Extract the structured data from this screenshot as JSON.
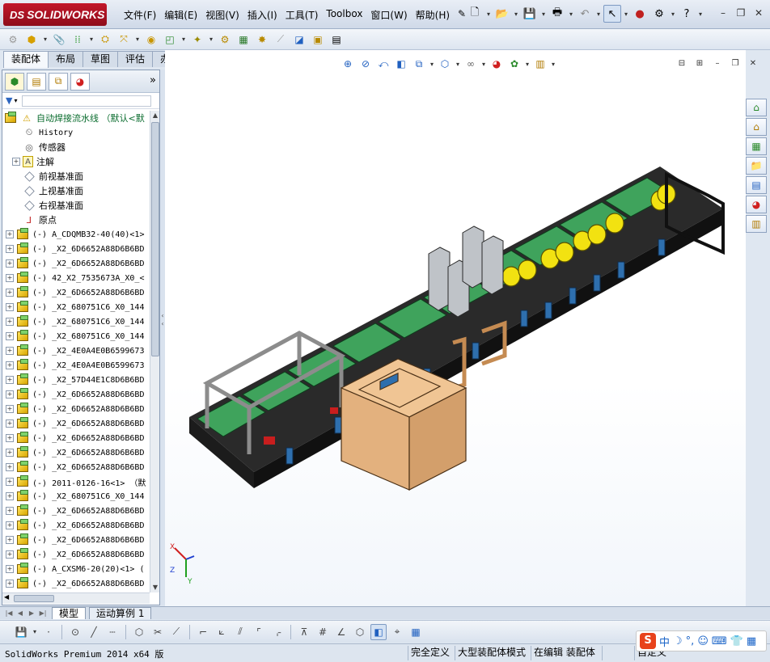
{
  "app": {
    "logo_ds": "DS",
    "logo_text": "SOLIDWORKS"
  },
  "menu": [
    "文件(F)",
    "编辑(E)",
    "视图(V)",
    "插入(I)",
    "工具(T)",
    "Toolbox",
    "窗口(W)",
    "帮助(H)"
  ],
  "cmd_tabs": [
    {
      "label": "装配体",
      "active": true
    },
    {
      "label": "布局",
      "active": false
    },
    {
      "label": "草图",
      "active": false
    },
    {
      "label": "评估",
      "active": false
    },
    {
      "label": "办公室产品",
      "active": false
    }
  ],
  "tree": {
    "root": "自动焊接流水线 （默认<默",
    "fixed_items": [
      {
        "label": "History",
        "icon": "history-icon",
        "expand": false,
        "mono": true
      },
      {
        "label": "传感器",
        "icon": "sensor-icon",
        "expand": false,
        "mono": false
      },
      {
        "label": "注解",
        "icon": "annotation-icon",
        "expand": true,
        "mono": false
      },
      {
        "label": "前视基准面",
        "icon": "plane-icon",
        "expand": false,
        "mono": false
      },
      {
        "label": "上视基准面",
        "icon": "plane-icon",
        "expand": false,
        "mono": false
      },
      {
        "label": "右视基准面",
        "icon": "plane-icon",
        "expand": false,
        "mono": false
      },
      {
        "label": "原点",
        "icon": "origin-icon",
        "expand": false,
        "mono": false
      }
    ],
    "components": [
      "(-) A_CDQMB32-40(40)<1>",
      "(-) _X2_6D6652A88D6B6BD",
      "(-) _X2_6D6652A88D6B6BD",
      "(-) 42_X2_7535673A_X0_<",
      "(-) _X2_6D6652A88D6B6BD",
      "(-) _X2_680751C6_X0_144",
      "(-) _X2_680751C6_X0_144",
      "(-) _X2_680751C6_X0_144",
      "(-) _X2_4E0A4E0B6599673",
      "(-) _X2_4E0A4E0B6599673",
      "(-) _X2_57D44E1C8D6B6BD",
      "(-) _X2_6D6652A88D6B6BD",
      "(-) _X2_6D6652A88D6B6BD",
      "(-) _X2_6D6652A88D6B6BD",
      "(-) _X2_6D6652A88D6B6BD",
      "(-) _X2_6D6652A88D6B6BD",
      "(-) _X2_6D6652A88D6B6BD",
      "(-) 2011-0126-16<1> （默",
      "(-) _X2_680751C6_X0_144",
      "(-) _X2_6D6652A88D6B6BD",
      "(-) _X2_6D6652A88D6B6BD",
      "(-) _X2_6D6652A88D6B6BD",
      "(-) _X2_6D6652A88D6B6BD",
      "(-) A_CXSM6-20(20)<1> (",
      "(-) _X2_6D6652A88D6B6BD"
    ]
  },
  "sheet_tabs": [
    {
      "label": "模型",
      "active": true
    },
    {
      "label": "运动算例 1",
      "active": false
    }
  ],
  "triad": {
    "x": "X",
    "y": "Y",
    "z": "Z"
  },
  "status": {
    "product": "SolidWorks Premium 2014 x64 版",
    "cells": [
      "完全定义",
      "大型装配体模式",
      "在编辑 装配体",
      "自定义"
    ]
  },
  "ime": {
    "s": "S",
    "items": [
      "中",
      "☽",
      "°,",
      "☺",
      "⌨",
      "👕",
      "▦"
    ]
  },
  "colors": {
    "accent": "#c3172a",
    "machine_orange": "#e3b17e",
    "machine_green": "#3fa35c",
    "roller_yellow": "#f2e211"
  }
}
